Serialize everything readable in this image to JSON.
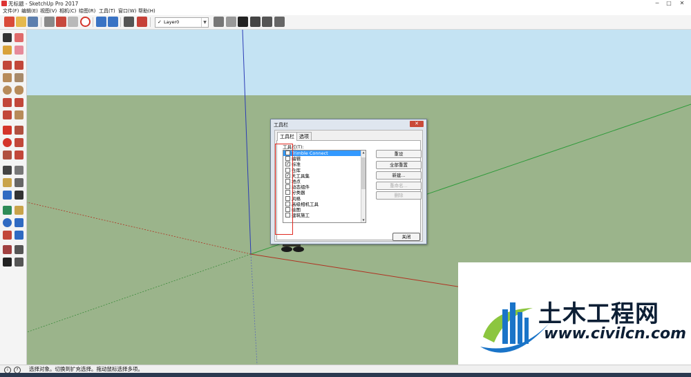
{
  "window": {
    "title": "无标题 - SketchUp Pro 2017"
  },
  "menu": [
    "文件(F)",
    "编辑(E)",
    "视图(V)",
    "相机(C)",
    "绘图(R)",
    "工具(T)",
    "窗口(W)",
    "帮助(H)"
  ],
  "layer": {
    "check": "✓",
    "name": "Layer0",
    "arrow": "▼"
  },
  "status": {
    "text": "选择对象。切换到扩充选择。拖动鼠标选择多项。",
    "icon1": "i",
    "icon2": "?"
  },
  "dialog": {
    "title": "工具栏",
    "close_glyph": "✕",
    "tabs": [
      "工具栏",
      "选项"
    ],
    "list_label": "工具栏(T):",
    "items": [
      {
        "label": "Trimble Connect",
        "checked": "",
        "selected": true
      },
      {
        "label": "编辑",
        "checked": "",
        "selected": false
      },
      {
        "label": "标准",
        "checked": "✓",
        "selected": false
      },
      {
        "label": "仓库",
        "checked": "",
        "selected": false
      },
      {
        "label": "大工具集",
        "checked": "✓",
        "selected": false
      },
      {
        "label": "地点",
        "checked": "",
        "selected": false
      },
      {
        "label": "动态组件",
        "checked": "",
        "selected": false
      },
      {
        "label": "分类器",
        "checked": "",
        "selected": false
      },
      {
        "label": "风格",
        "checked": "",
        "selected": false
      },
      {
        "label": "高级相机工具",
        "checked": "",
        "selected": false
      },
      {
        "label": "绘图",
        "checked": "",
        "selected": false
      },
      {
        "label": "建筑施工",
        "checked": "",
        "selected": false
      }
    ],
    "buttons": {
      "reset": "重设",
      "reset_all": "全部重置",
      "new": "新建...",
      "rename": "重命名...",
      "delete": "删除"
    },
    "close_label": "关闭"
  },
  "watermark": {
    "title": "土木工程网",
    "url": "www.civilcn.com"
  },
  "colors": {
    "sky": "#c4e3f3",
    "ground": "#9bb48b",
    "accent_red": "#e0281f",
    "brand_blue": "#1a74c8"
  }
}
